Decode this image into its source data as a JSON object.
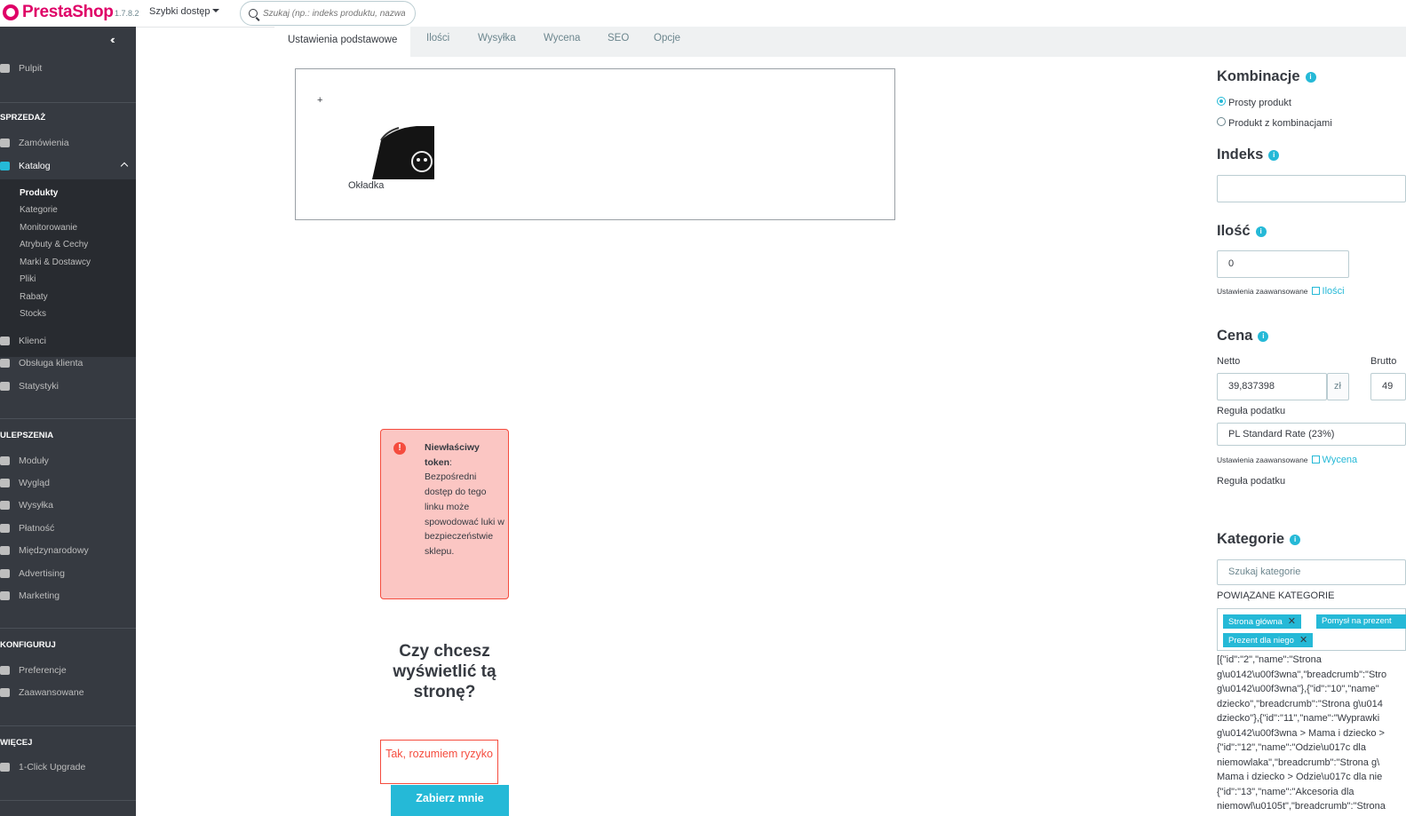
{
  "header": {
    "brand": "PrestaShop",
    "version": "1.7.8.2",
    "quick_access": "Szybki dostęp",
    "search_placeholder": "Szukaj (np.: indeks produktu, nazwa k..."
  },
  "sidebar": {
    "dashboard": "Pulpit",
    "sections": {
      "sales": "SPRZEDAŻ",
      "improve": "ULEPSZENIA",
      "configure": "KONFIGURUJ",
      "more": "WIĘCEJ"
    },
    "orders": "Zamówienia",
    "catalog": "Katalog",
    "catalog_sub": [
      "Produkty",
      "Kategorie",
      "Monitorowanie",
      "Atrybuty & Cechy",
      "Marki & Dostawcy",
      "Pliki",
      "Rabaty",
      "Stocks"
    ],
    "customers": "Klienci",
    "customer_service": "Obsługa klienta",
    "stats": "Statystyki",
    "modules": "Moduły",
    "design": "Wygląd",
    "shipping": "Wysyłka",
    "payment": "Płatność",
    "international": "Międzynarodowy",
    "advertising": "Advertising",
    "marketing": "Marketing",
    "preferences": "Preferencje",
    "advanced": "Zaawansowane",
    "upgrade": "1-Click Upgrade"
  },
  "tabs": [
    "Ustawienia podstawowe",
    "Ilości",
    "Wysyłka",
    "Wycena",
    "SEO",
    "Opcje"
  ],
  "image_box": {
    "plus": "+",
    "cover_label": "Okładka"
  },
  "alert": {
    "title": "Niewłaściwy token",
    "message": ": Bezpośredni dostęp do tego linku może spowodować luki w bezpieczeństwie sklepu."
  },
  "prompt": {
    "question": "Czy chcesz wyświetlić tą stronę?",
    "accept": "Tak, rozumiem ryzyko",
    "back": "Zabierz mnie"
  },
  "right": {
    "combinations_title": "Kombinacje",
    "simple_product": "Prosty produkt",
    "with_combinations": "Produkt z kombinacjami",
    "index_title": "Indeks",
    "index_value": "",
    "qty_title": "Ilość",
    "qty_value": "0",
    "advanced_settings": "Ustawienia zaawansowane",
    "qty_link": "Ilości",
    "price_title": "Cena",
    "net_label": "Netto",
    "net_value": "39,837398",
    "currency": "zł",
    "gross_label": "Brutto",
    "gross_value": "49",
    "tax_rule_label": "Reguła podatku",
    "tax_rule_value": "PL Standard Rate (23%)",
    "price_link": "Wycena",
    "tax_rule_label2": "Reguła podatku",
    "categories_title": "Kategorie",
    "category_search_placeholder": "Szukaj kategorie",
    "related_categories": "POWIĄZANE KATEGORIE",
    "tags": [
      "Strona główna",
      "Pomysł na prezent",
      "Prezent dla niego"
    ],
    "json_dump": "[{\"id\":\"2\",\"name\":\"Strona\ng\\u0142\\u00f3wna\",\"breadcrumb\":\"Stro\ng\\u0142\\u00f3wna\"},{\"id\":\"10\",\"name\"\ndziecko\",\"breadcrumb\":\"Strona g\\u014\ndziecko\"},{\"id\":\"11\",\"name\":\"Wyprawki\ng\\u0142\\u00f3wna > Mama i dziecko >\n{\"id\":\"12\",\"name\":\"Odzie\\u017c dla\nniemowlaka\",\"breadcrumb\":\"Strona g\\\nMama i dziecko > Odzie\\u017c dla nie\n{\"id\":\"13\",\"name\":\"Akcesoria dla\nniemowl\\u0105t\",\"breadcrumb\":\"Strona"
  }
}
